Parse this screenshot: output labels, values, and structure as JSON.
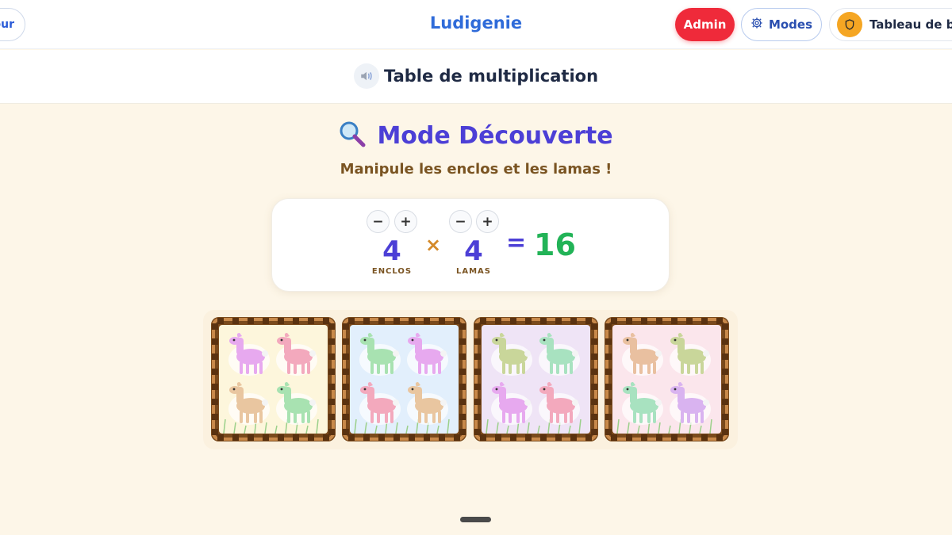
{
  "header": {
    "back_label": "our",
    "brand": "Ludigenie",
    "admin_label": "Admin",
    "modes_label": "Modes",
    "dashboard_label": "Tableau de bo"
  },
  "subheader": {
    "title": "Table de multiplication"
  },
  "mode": {
    "icon": "magnifier-icon",
    "title": "Mode Découverte",
    "subtitle": "Manipule les enclos et les lamas !"
  },
  "equation": {
    "left_value": "4",
    "left_label": "ENCLOS",
    "operator": "×",
    "right_value": "4",
    "right_label": "LAMAS",
    "equals": "=",
    "result": "16",
    "minus": "−",
    "plus": "+"
  },
  "pens": [
    {
      "background": "#fdf6dc",
      "llamas": [
        "#e7a9ef",
        "#f3a9bd",
        "#e9c6a0",
        "#a8e2b1"
      ]
    },
    {
      "background": "#e2effc",
      "llamas": [
        "#a8e2b1",
        "#e7a9ef",
        "#f3a9bd",
        "#e9c6a0"
      ]
    },
    {
      "background": "#efe4f6",
      "llamas": [
        "#c9d69a",
        "#a8e2c0",
        "#e7a9ef",
        "#f3a9bd"
      ]
    },
    {
      "background": "#fbe6ec",
      "llamas": [
        "#e9c0a0",
        "#c9d69a",
        "#a8e2c0",
        "#d9b3f0"
      ]
    }
  ],
  "colors": {
    "brand": "#2f6bd9",
    "admin": "#ef2a3a",
    "accent": "#4c3fd6",
    "result": "#22b357",
    "background": "#fdf6e8"
  }
}
